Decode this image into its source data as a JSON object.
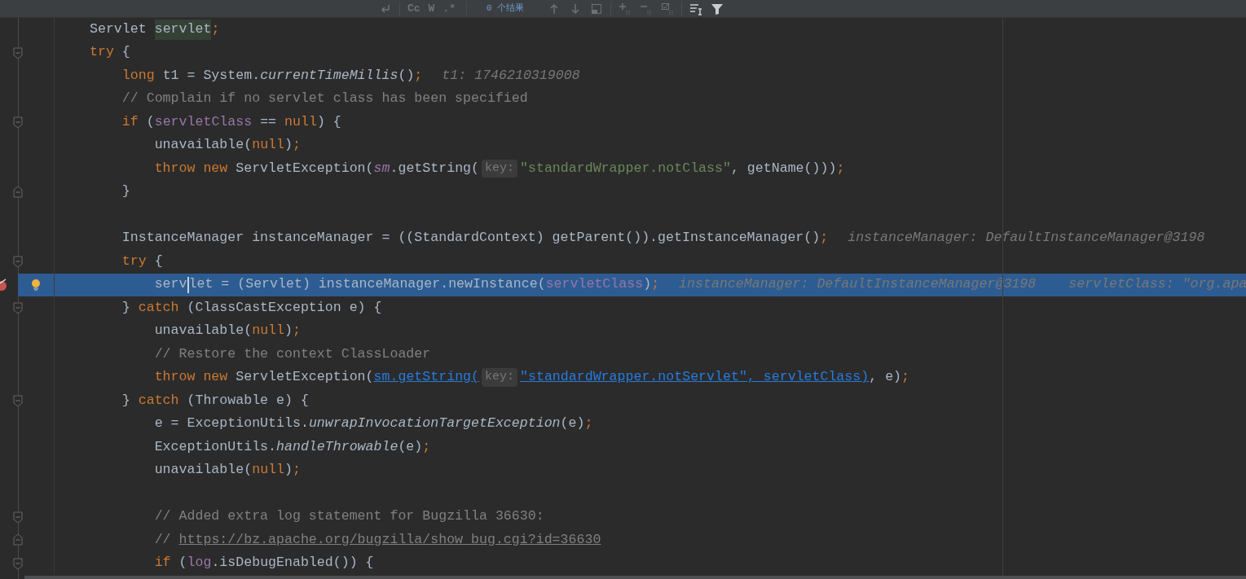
{
  "find_bar": {
    "result_count": "0 个结果",
    "buttons": [
      {
        "kind": "newline",
        "disabled": true
      },
      {
        "kind": "text",
        "label": "Cc",
        "disabled": true
      },
      {
        "kind": "text",
        "label": "W",
        "disabled": true
      },
      {
        "kind": "text",
        "label": ".*",
        "disabled": true
      },
      {
        "kind": "separator"
      },
      {
        "kind": "up",
        "disabled": true
      },
      {
        "kind": "down",
        "disabled": true
      },
      {
        "kind": "window",
        "disabled": true
      },
      {
        "kind": "add",
        "disabled": true
      },
      {
        "kind": "remove",
        "disabled": true
      },
      {
        "kind": "select",
        "disabled": true
      },
      {
        "kind": "lines",
        "disabled": false
      },
      {
        "kind": "filter",
        "disabled": false
      }
    ]
  },
  "lines": [
    {
      "fold_open": false,
      "fold_close": false,
      "selected": false,
      "tokens": [
        {
          "kind": "plain",
          "text": "Servlet "
        },
        {
          "kind": "highlight",
          "text": "servlet"
        },
        {
          "kind": "punct",
          "text": ";"
        }
      ]
    },
    {
      "fold_open": true,
      "fold_close": false,
      "selected": false,
      "tokens": [
        {
          "kind": "keyword",
          "text": "try "
        },
        {
          "kind": "plain",
          "text": "{"
        }
      ]
    },
    {
      "fold_open": false,
      "fold_close": false,
      "selected": false,
      "tokens": [
        {
          "kind": "keyword",
          "text": "    long "
        },
        {
          "kind": "plain",
          "text": "t1 = System."
        },
        {
          "kind": "static_method",
          "text": "currentTimeMillis"
        },
        {
          "kind": "plain",
          "text": "()"
        },
        {
          "kind": "punct",
          "text": ";"
        },
        {
          "kind": "debug",
          "text": "t1: 1746210319008"
        }
      ]
    },
    {
      "fold_open": false,
      "fold_close": false,
      "selected": false,
      "tokens": [
        {
          "kind": "comment",
          "text": "    // Complain if no servlet class has been specified"
        }
      ]
    },
    {
      "fold_open": true,
      "fold_close": false,
      "selected": false,
      "tokens": [
        {
          "kind": "keyword",
          "text": "    if "
        },
        {
          "kind": "plain",
          "text": "("
        },
        {
          "kind": "field",
          "text": "servletClass"
        },
        {
          "kind": "plain",
          "text": " == "
        },
        {
          "kind": "keyword",
          "text": "null"
        },
        {
          "kind": "plain",
          "text": ") {"
        }
      ]
    },
    {
      "fold_open": false,
      "fold_close": false,
      "selected": false,
      "tokens": [
        {
          "kind": "plain",
          "text": "        unavailable("
        },
        {
          "kind": "keyword",
          "text": "null"
        },
        {
          "kind": "plain",
          "text": ")"
        },
        {
          "kind": "punct",
          "text": ";"
        }
      ]
    },
    {
      "fold_open": false,
      "fold_close": false,
      "selected": false,
      "tokens": [
        {
          "kind": "keyword",
          "text": "        throw new "
        },
        {
          "kind": "plain",
          "text": "ServletException("
        },
        {
          "kind": "static_field",
          "text": "sm"
        },
        {
          "kind": "plain",
          "text": ".getString("
        },
        {
          "kind": "hint",
          "text": "key:"
        },
        {
          "kind": "string",
          "text": "\"standardWrapper.notClass\""
        },
        {
          "kind": "plain",
          "text": ", getName()))"
        },
        {
          "kind": "punct",
          "text": ";"
        }
      ]
    },
    {
      "fold_open": false,
      "fold_close": true,
      "selected": false,
      "tokens": [
        {
          "kind": "plain",
          "text": "    }"
        }
      ]
    },
    {
      "fold_open": false,
      "fold_close": false,
      "selected": false
    },
    {
      "fold_open": false,
      "fold_close": false,
      "selected": false,
      "tokens": [
        {
          "kind": "plain",
          "text": "    InstanceManager instanceManager = ((StandardContext) getParent()).getInstanceManager()"
        },
        {
          "kind": "punct",
          "text": ";"
        },
        {
          "kind": "debug",
          "text": "instanceManager: DefaultInstanceManager@3198"
        }
      ]
    },
    {
      "fold_open": true,
      "fold_close": false,
      "selected": false,
      "tokens": [
        {
          "kind": "keyword",
          "text": "    try "
        },
        {
          "kind": "plain",
          "text": "{"
        }
      ]
    },
    {
      "fold_open": false,
      "fold_close": false,
      "selected": true,
      "breakpoint": true,
      "bulb": true,
      "tokens": [
        {
          "kind": "plain",
          "text": "        serv",
          "caret": true
        },
        {
          "kind": "plain",
          "text": "let = (Servlet) instanceManager.newInstance("
        },
        {
          "kind": "field",
          "text": "servletClass"
        },
        {
          "kind": "plain",
          "text": ")"
        },
        {
          "kind": "punct",
          "text": ";"
        },
        {
          "kind": "debug",
          "text": "instanceManager: DefaultInstanceManager@3198"
        },
        {
          "kind": "debug",
          "text": "servletClass: \"org.apa"
        }
      ]
    },
    {
      "fold_open": true,
      "fold_close": false,
      "selected": false,
      "tokens": [
        {
          "kind": "plain",
          "text": "    } "
        },
        {
          "kind": "keyword",
          "text": "catch "
        },
        {
          "kind": "plain",
          "text": "(ClassCastException e) {"
        }
      ]
    },
    {
      "fold_open": false,
      "fold_close": false,
      "selected": false,
      "tokens": [
        {
          "kind": "plain",
          "text": "        unavailable("
        },
        {
          "kind": "keyword",
          "text": "null"
        },
        {
          "kind": "plain",
          "text": ")"
        },
        {
          "kind": "punct",
          "text": ";"
        }
      ]
    },
    {
      "fold_open": false,
      "fold_close": false,
      "selected": false,
      "tokens": [
        {
          "kind": "comment",
          "text": "        // Restore the context ClassLoader"
        }
      ]
    },
    {
      "fold_open": false,
      "fold_close": false,
      "selected": false,
      "tokens": [
        {
          "kind": "keyword",
          "text": "        throw new "
        },
        {
          "kind": "plain",
          "text": "ServletException("
        },
        {
          "kind": "link",
          "text": "sm.getString("
        },
        {
          "kind": "hint",
          "text": "key:"
        },
        {
          "kind": "link",
          "text": "\"standardWrapper.notServlet\", servletClass)"
        },
        {
          "kind": "plain",
          "text": ", e)"
        },
        {
          "kind": "punct",
          "text": ";"
        }
      ]
    },
    {
      "fold_open": true,
      "fold_close": false,
      "selected": false,
      "tokens": [
        {
          "kind": "plain",
          "text": "    } "
        },
        {
          "kind": "keyword",
          "text": "catch "
        },
        {
          "kind": "plain",
          "text": "(Throwable e) {"
        }
      ]
    },
    {
      "fold_open": false,
      "fold_close": false,
      "selected": false,
      "tokens": [
        {
          "kind": "plain",
          "text": "        e = ExceptionUtils."
        },
        {
          "kind": "static_method",
          "text": "unwrapInvocationTargetException"
        },
        {
          "kind": "plain",
          "text": "(e)"
        },
        {
          "kind": "punct",
          "text": ";"
        }
      ]
    },
    {
      "fold_open": false,
      "fold_close": false,
      "selected": false,
      "tokens": [
        {
          "kind": "plain",
          "text": "        ExceptionUtils."
        },
        {
          "kind": "static_method",
          "text": "handleThrowable"
        },
        {
          "kind": "plain",
          "text": "(e)"
        },
        {
          "kind": "punct",
          "text": ";"
        }
      ]
    },
    {
      "fold_open": false,
      "fold_close": false,
      "selected": false,
      "tokens": [
        {
          "kind": "plain",
          "text": "        unavailable("
        },
        {
          "kind": "keyword",
          "text": "null"
        },
        {
          "kind": "plain",
          "text": ")"
        },
        {
          "kind": "punct",
          "text": ";"
        }
      ]
    },
    {
      "fold_open": false,
      "fold_close": false,
      "selected": false
    },
    {
      "fold_open": true,
      "fold_close": false,
      "selected": false,
      "tokens": [
        {
          "kind": "comment",
          "text": "        // Added extra log statement for Bugzilla 36630:"
        }
      ]
    },
    {
      "fold_open": false,
      "fold_close": true,
      "selected": false,
      "tokens": [
        {
          "kind": "comment",
          "text": "        // "
        },
        {
          "kind": "comment_link",
          "text": "https://bz.apache.org/bugzilla/show_bug.cgi?id=36630"
        }
      ]
    },
    {
      "fold_open": true,
      "fold_close": false,
      "selected": false,
      "tokens": [
        {
          "kind": "keyword",
          "text": "        if "
        },
        {
          "kind": "plain",
          "text": "("
        },
        {
          "kind": "field",
          "text": "log"
        },
        {
          "kind": "plain",
          "text": ".isDebugEnabled()) {"
        }
      ]
    }
  ]
}
